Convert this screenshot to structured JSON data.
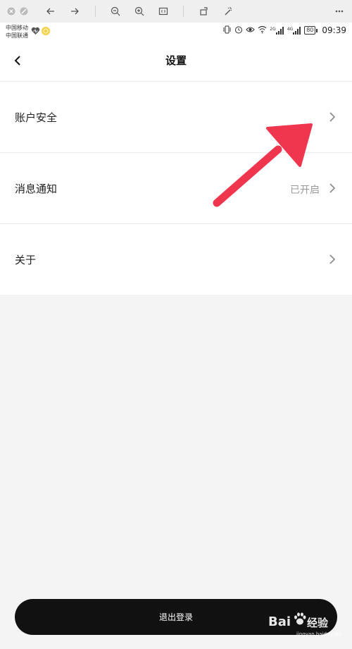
{
  "status_bar": {
    "carrier_1": "中国移动",
    "carrier_2": "中国联通",
    "network_1": "2G",
    "network_2": "4G",
    "battery": "80",
    "time": "09:39"
  },
  "nav": {
    "title": "设置"
  },
  "settings": {
    "items": [
      {
        "label": "账户安全",
        "value": ""
      },
      {
        "label": "消息通知",
        "value": "已开启"
      },
      {
        "label": "关于",
        "value": ""
      }
    ]
  },
  "logout": {
    "label": "退出登录"
  },
  "watermark": {
    "brand": "Bai",
    "brand2": "经验",
    "sub": "jingyan.baidu.com"
  },
  "colors": {
    "annotation_arrow": "#f0354e",
    "logout_bg": "#111111",
    "page_bg": "#f4f4f4"
  }
}
